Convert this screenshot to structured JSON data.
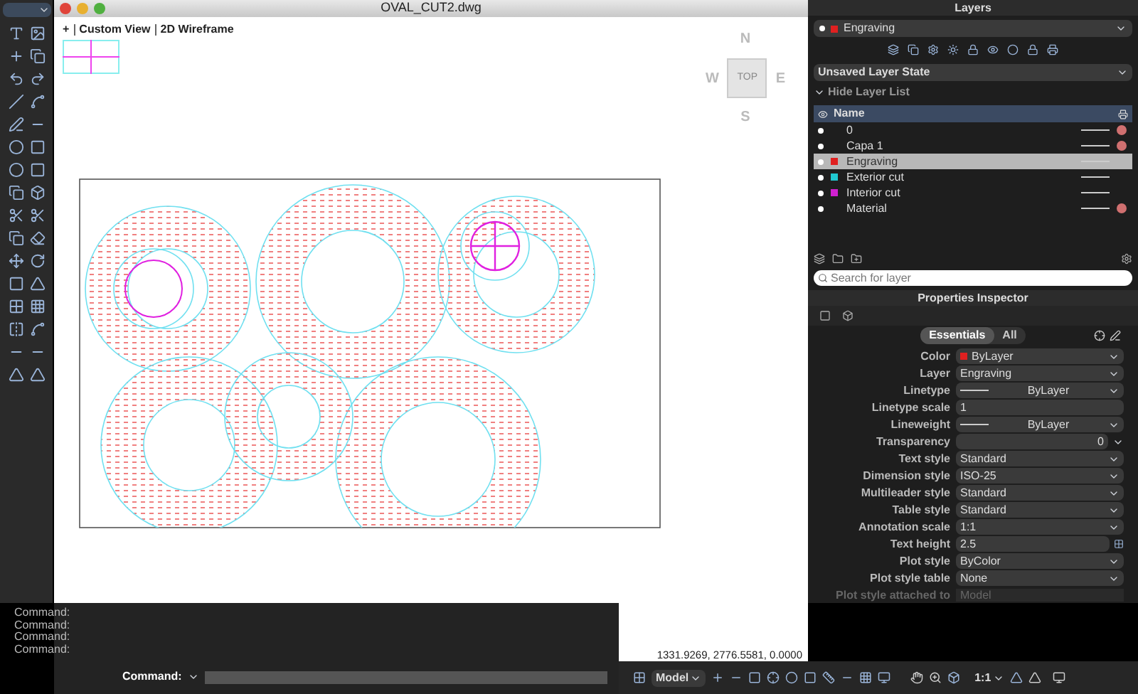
{
  "window": {
    "title": "OVAL_CUT2.dwg"
  },
  "viewport": {
    "menu": "+",
    "view": "Custom View",
    "style": "2D Wireframe",
    "viewcube": {
      "north": "N",
      "south": "S",
      "east": "E",
      "west": "W",
      "face": "TOP"
    },
    "coordinates": "1331.9269, 2776.5581, 0.0000"
  },
  "command_line": {
    "history": [
      "Command:",
      "Command:",
      "Command:",
      "Command:"
    ],
    "prompt": "Command:"
  },
  "status_bar": {
    "space": "Model",
    "annotation_scale": "1:1"
  },
  "layers": {
    "title": "Layers",
    "current_layer": {
      "name": "Engraving",
      "color": "#e02020"
    },
    "layer_state": "Unsaved Layer State",
    "toggle": "Hide Layer List",
    "column": "Name",
    "rows": [
      {
        "name": "0",
        "selected": false,
        "no_plot": true
      },
      {
        "name": "Capa 1",
        "selected": false,
        "no_plot": true
      },
      {
        "name": "Engraving",
        "color": "#e02020",
        "selected": true,
        "no_plot": false
      },
      {
        "name": "Exterior cut",
        "color": "#20c8d0",
        "selected": false,
        "no_plot": false
      },
      {
        "name": "Interior cut",
        "color": "#d020d0",
        "selected": false,
        "no_plot": false
      },
      {
        "name": "Material",
        "selected": false,
        "no_plot": true
      }
    ],
    "search": {
      "placeholder": "Search for layer"
    }
  },
  "properties": {
    "title": "Properties Inspector",
    "tabs": [
      {
        "label": "Essentials",
        "selected": true
      },
      {
        "label": "All",
        "selected": false
      }
    ],
    "rows": [
      {
        "kind": "color",
        "label": "Color",
        "value": "ByLayer",
        "color": "#e02020"
      },
      {
        "kind": "dropdown",
        "label": "Layer",
        "value": "Engraving"
      },
      {
        "kind": "linetype",
        "label": "Linetype",
        "value": "ByLayer"
      },
      {
        "kind": "input",
        "label": "Linetype scale",
        "value": "1"
      },
      {
        "kind": "linetype",
        "label": "Lineweight",
        "value": "ByLayer"
      },
      {
        "kind": "transparency",
        "label": "Transparency",
        "value": "0"
      },
      {
        "kind": "dropdown",
        "label": "Text style",
        "value": "Standard"
      },
      {
        "kind": "dropdown",
        "label": "Dimension style",
        "value": "ISO-25"
      },
      {
        "kind": "dropdown",
        "label": "Multileader style",
        "value": "Standard"
      },
      {
        "kind": "dropdown",
        "label": "Table style",
        "value": "Standard"
      },
      {
        "kind": "dropdown",
        "label": "Annotation scale",
        "value": "1:1"
      },
      {
        "kind": "spin",
        "label": "Text height",
        "value": "2.5"
      },
      {
        "kind": "dropdown",
        "label": "Plot style",
        "value": "ByColor"
      },
      {
        "kind": "dropdown",
        "label": "Plot style table",
        "value": "None"
      },
      {
        "kind": "disabled",
        "label": "Plot style attached to",
        "value": "Model"
      }
    ]
  }
}
